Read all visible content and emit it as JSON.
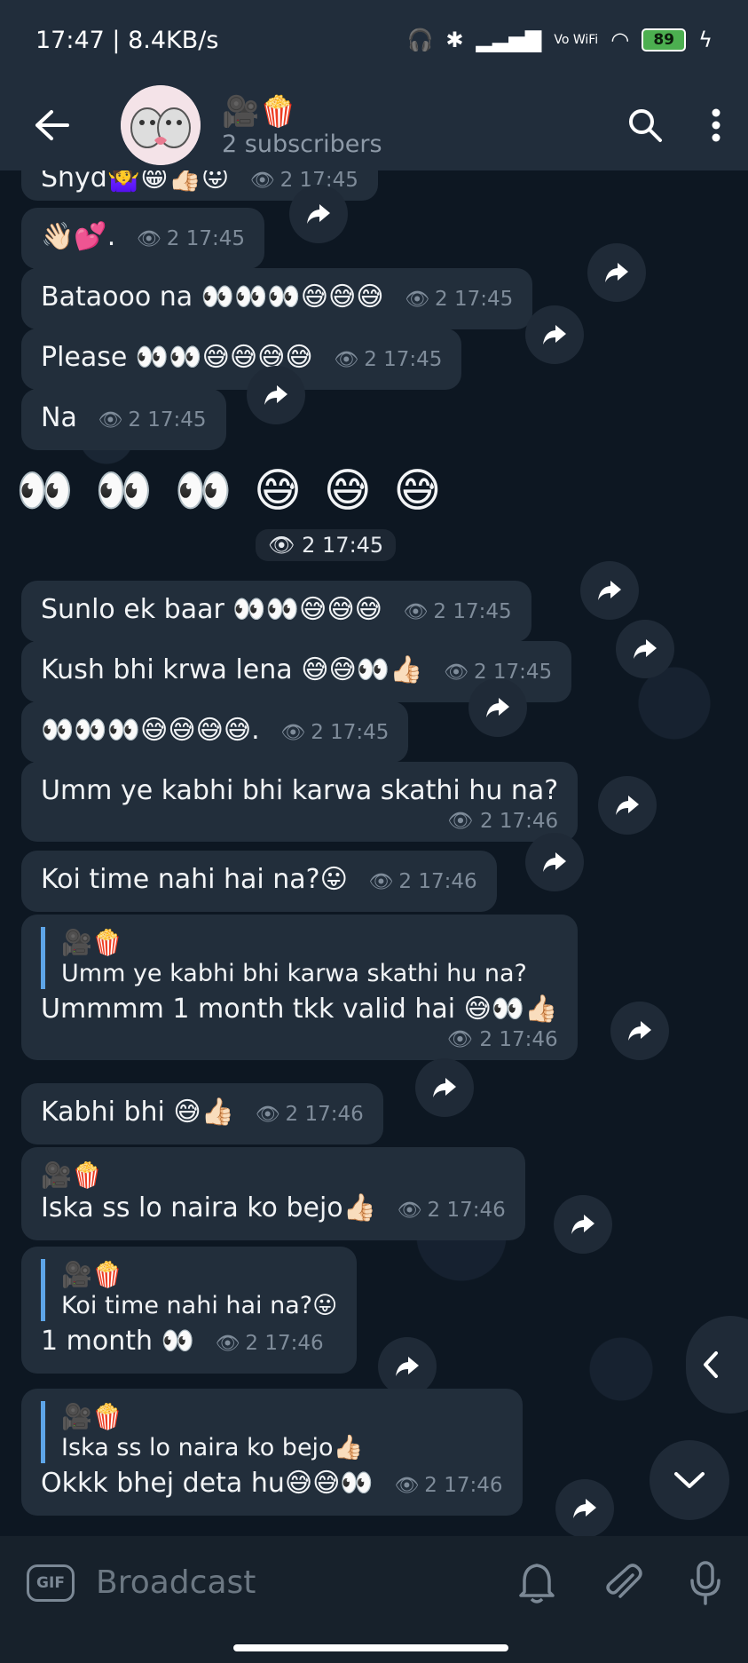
{
  "status_bar": {
    "time_speed": "17:47 | 8.4KB/s",
    "vowifi": "Vo WiFi",
    "battery": "89"
  },
  "header": {
    "title": "🎥🍿",
    "subtitle": "2 subscribers"
  },
  "messages": [
    {
      "text": "Shyd🤷‍♀️😁👍🏻😛",
      "views": "2",
      "time": "17:45"
    },
    {
      "text": "👋🏻💕.",
      "views": "2",
      "time": "17:45"
    },
    {
      "text": "Bataooo na 👀👀👀😅😅😅",
      "views": "2",
      "time": "17:45"
    },
    {
      "text": "Please 👀👀😅😅😅😅",
      "views": "2",
      "time": "17:45"
    },
    {
      "text": "Na",
      "views": "2",
      "time": "17:45"
    },
    {
      "text": "👀 👀 👀 😅 😅 😅",
      "views": "2",
      "time": "17:45"
    },
    {
      "text": "Sunlo ek baar 👀👀😅😅😅",
      "views": "2",
      "time": "17:45"
    },
    {
      "text": "Kush bhi krwa lena 😅😅👀👍🏻",
      "views": "2",
      "time": "17:45"
    },
    {
      "text": "👀👀👀😅😅😅😅.",
      "views": "2",
      "time": "17:45"
    },
    {
      "text": "Umm ye kabhi bhi karwa skathi hu na?",
      "views": "2",
      "time": "17:46"
    },
    {
      "text": "Koi time nahi hai na?😛",
      "views": "2",
      "time": "17:46"
    },
    {
      "reply_author": "🎥🍿",
      "reply_text": "Umm ye kabhi bhi karwa skathi hu na?",
      "text": "Ummmm 1 month tkk valid hai 😅👀👍🏻",
      "views": "2",
      "time": "17:46"
    },
    {
      "text": "Kabhi bhi 😅👍🏻",
      "views": "2",
      "time": "17:46"
    },
    {
      "author": "🎥🍿",
      "text": "Iska ss lo naira ko bejo👍🏻",
      "views": "2",
      "time": "17:46"
    },
    {
      "reply_author": "🎥🍿",
      "reply_text": "Koi time nahi hai na?😛",
      "text": "1 month 👀",
      "views": "2",
      "time": "17:46"
    },
    {
      "reply_author": "🎥🍿",
      "reply_text": "Iska ss lo naira ko bejo👍🏻",
      "text": "Okkk bhej deta hu😅😅👀",
      "views": "2",
      "time": "17:46"
    }
  ],
  "composer": {
    "gif_label": "GIF",
    "placeholder": "Broadcast"
  }
}
